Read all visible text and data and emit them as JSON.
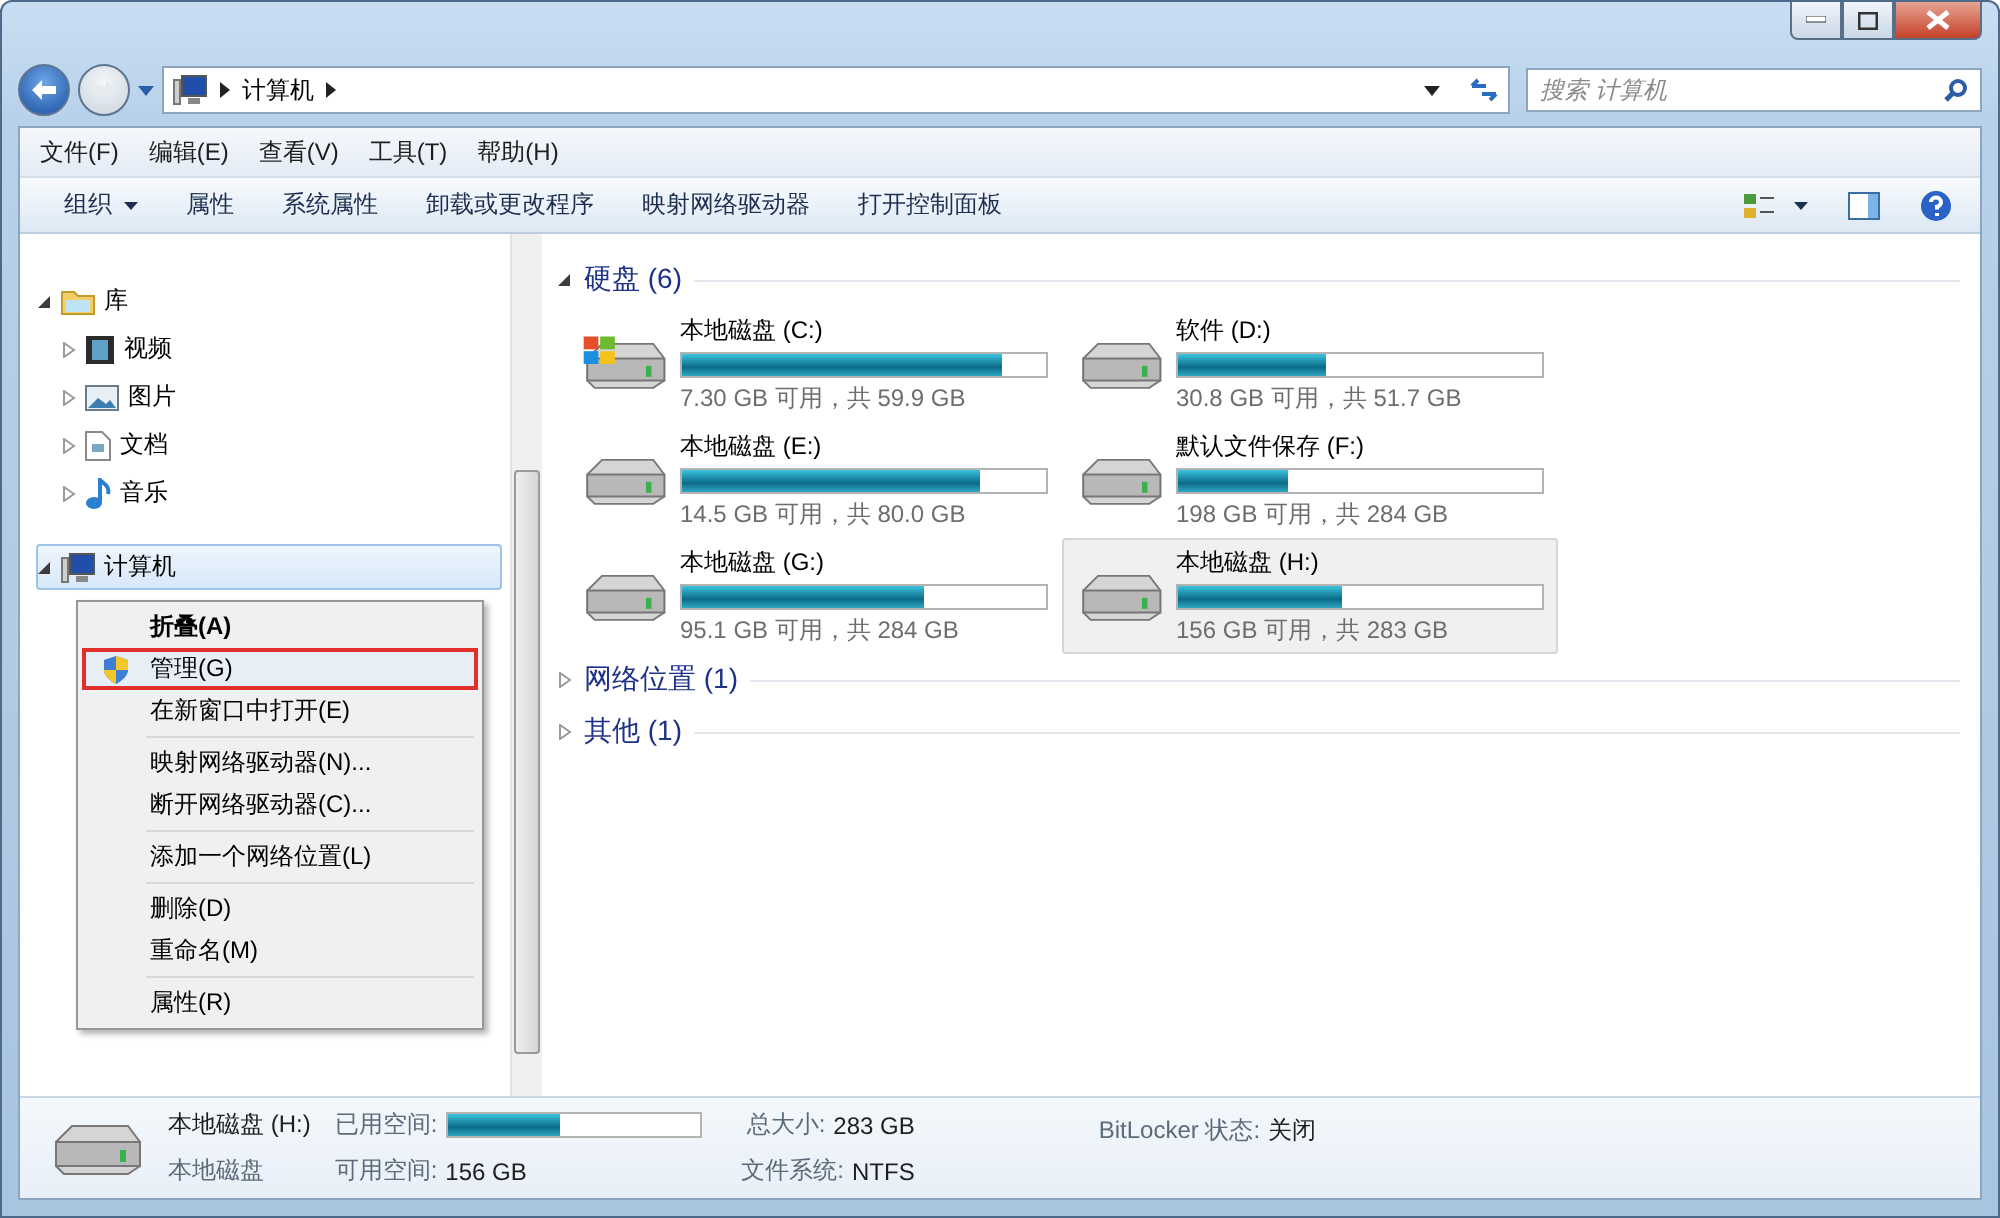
{
  "address_bar": {
    "path": [
      "计算机"
    ],
    "search_placeholder": "搜索 计算机"
  },
  "menu_bar": [
    "文件(F)",
    "编辑(E)",
    "查看(V)",
    "工具(T)",
    "帮助(H)"
  ],
  "toolbar": [
    {
      "label": "组织",
      "dropdown": true
    },
    {
      "label": "属性",
      "dropdown": false
    },
    {
      "label": "系统属性",
      "dropdown": false
    },
    {
      "label": "卸载或更改程序",
      "dropdown": false
    },
    {
      "label": "映射网络驱动器",
      "dropdown": false
    },
    {
      "label": "打开控制面板",
      "dropdown": false
    }
  ],
  "sidebar": {
    "items": [
      {
        "label": "库",
        "kind": "library",
        "expanded": true,
        "selected": false,
        "children": [
          {
            "label": "视频",
            "kind": "video",
            "expanded": false,
            "selected": false
          },
          {
            "label": "图片",
            "kind": "picture",
            "expanded": false,
            "selected": false
          },
          {
            "label": "文档",
            "kind": "document",
            "expanded": false,
            "selected": false
          },
          {
            "label": "音乐",
            "kind": "music",
            "expanded": false,
            "selected": false
          }
        ]
      },
      {
        "label": "计算机",
        "kind": "computer",
        "expanded": true,
        "selected": true
      }
    ]
  },
  "context_menu": [
    {
      "kind": "item",
      "label": "折叠(A)",
      "default": true,
      "selected": false
    },
    {
      "kind": "admin",
      "label": "管理(G)",
      "default": false,
      "selected": true
    },
    {
      "kind": "item",
      "label": "在新窗口中打开(E)",
      "default": false,
      "selected": false
    },
    {
      "kind": "separator"
    },
    {
      "kind": "item",
      "label": "映射网络驱动器(N)...",
      "default": false,
      "selected": false
    },
    {
      "kind": "item",
      "label": "断开网络驱动器(C)...",
      "default": false,
      "selected": false
    },
    {
      "kind": "separator"
    },
    {
      "kind": "item",
      "label": "添加一个网络位置(L)",
      "default": false,
      "selected": false
    },
    {
      "kind": "separator"
    },
    {
      "kind": "item",
      "label": "删除(D)",
      "default": false,
      "selected": false
    },
    {
      "kind": "item",
      "label": "重命名(M)",
      "default": false,
      "selected": false
    },
    {
      "kind": "separator"
    },
    {
      "kind": "item",
      "label": "属性(R)",
      "default": false,
      "selected": false
    }
  ],
  "groups": [
    {
      "title": "硬盘 (6)",
      "expanded": true,
      "drives": [
        {
          "name": "本地磁盘 (C:)",
          "level": 0.878,
          "space": "7.30 GB 可用，共 59.9 GB",
          "system": true,
          "selected": false
        },
        {
          "name": "软件 (D:)",
          "level": 0.404,
          "space": "30.8 GB 可用，共 51.7 GB",
          "system": false,
          "selected": false
        },
        {
          "name": "本地磁盘 (E:)",
          "level": 0.819,
          "space": "14.5 GB 可用，共 80.0 GB",
          "system": false,
          "selected": false
        },
        {
          "name": "默认文件保存 (F:)",
          "level": 0.303,
          "space": "198 GB 可用，共 284 GB",
          "system": false,
          "selected": false
        },
        {
          "name": "本地磁盘 (G:)",
          "level": 0.665,
          "space": "95.1 GB 可用，共 284 GB",
          "system": false,
          "selected": false
        },
        {
          "name": "本地磁盘 (H:)",
          "level": 0.449,
          "space": "156 GB 可用，共 283 GB",
          "system": false,
          "selected": true
        }
      ]
    },
    {
      "title": "网络位置 (1)",
      "expanded": false
    },
    {
      "title": "其他 (1)",
      "expanded": false
    }
  ],
  "status_bar": {
    "name": "本地磁盘 (H:)",
    "type": "本地磁盘",
    "used_label": "已用空间:",
    "level": 0.449,
    "free_label": "可用空间:",
    "free": "156 GB",
    "total_label": "总大小:",
    "total": "283 GB",
    "fs_label": "文件系统:",
    "fs": "NTFS",
    "bitlocker_label": "BitLocker 状态:",
    "bitlocker": "关闭"
  }
}
